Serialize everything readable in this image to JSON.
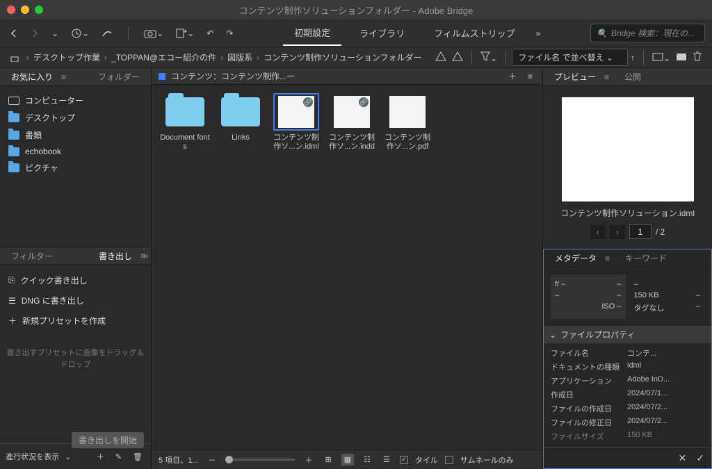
{
  "window": {
    "title": "コンテンツ制作ソリューションフォルダー - Adobe Bridge"
  },
  "workspaces": {
    "w1": "初期設定",
    "w2": "ライブラリ",
    "w3": "フィルムストリップ"
  },
  "search": {
    "placeholder": "Bridge 検索：現在の..."
  },
  "breadcrumb": {
    "b1": "デスクトップ作業",
    "b2": "_TOPPAN@エコー紹介の件",
    "b3": "図版系",
    "b4": "コンテンツ制作ソリューションフォルダー"
  },
  "sort": {
    "label": "ファイル名 で並べ替え"
  },
  "panels": {
    "favorites": "お気に入り",
    "folders": "フォルダー",
    "filter": "フィルター",
    "export": "書き出し",
    "preview": "プレビュー",
    "publish": "公開",
    "metadata": "メタデータ",
    "keywords": "キーワード"
  },
  "favorites": {
    "i1": "コンピューター",
    "i2": "デスクトップ",
    "i3": "書類",
    "i4": "echobook",
    "i5": "ピクチャ"
  },
  "content": {
    "header": "コンテンツ：コンテンツ制作...ー",
    "items": {
      "n1": "Document fonts",
      "n2": "Links",
      "n3": "コンテンツ制作ソ...ン.idml",
      "n4": "コンテンツ制作ソ...ン.indd",
      "n5": "コンテンツ制作ソ...ン.pdf"
    },
    "status": "5 項目、1...",
    "tile_label": "タイル",
    "thumb_only_label": "サムネールのみ"
  },
  "export": {
    "quick": "クイック書き出し",
    "dng": "DNG に書き出し",
    "newpreset": "新規プリセットを作成",
    "hint": "書き出すプリセットに画像をドラッグ＆ドロップ",
    "start": "書き出しを開始",
    "progress": "進行状況を表示"
  },
  "preview": {
    "caption": "コンテンツ制作ソリューション.idml",
    "page": "1",
    "total": "/ 2"
  },
  "meta": {
    "fstop": "f/ –",
    "fstop_v": "–",
    "r2a": "–",
    "r2b": "–",
    "iso": "ISO –",
    "iso_v": "–",
    "size": "150 KB",
    "size2": "–",
    "tag": "タグなし",
    "tag2": "–",
    "section": "ファイルプロパティ",
    "p_name_l": "ファイル名",
    "p_name_v": "コンテ...",
    "p_type_l": "ドキュメントの種類",
    "p_type_v": "idml",
    "p_app_l": "アプリケーション",
    "p_app_v": "Adobe InD...",
    "p_created_l": "作成日",
    "p_created_v": "2024/07/1...",
    "p_fcreated_l": "ファイルの作成日",
    "p_fcreated_v": "2024/07/2...",
    "p_fmod_l": "ファイルの修正日",
    "p_fmod_v": "2024/07/2...",
    "p_fsize_l": "ファイルサイズ",
    "p_fsize_v": "150 KB"
  }
}
